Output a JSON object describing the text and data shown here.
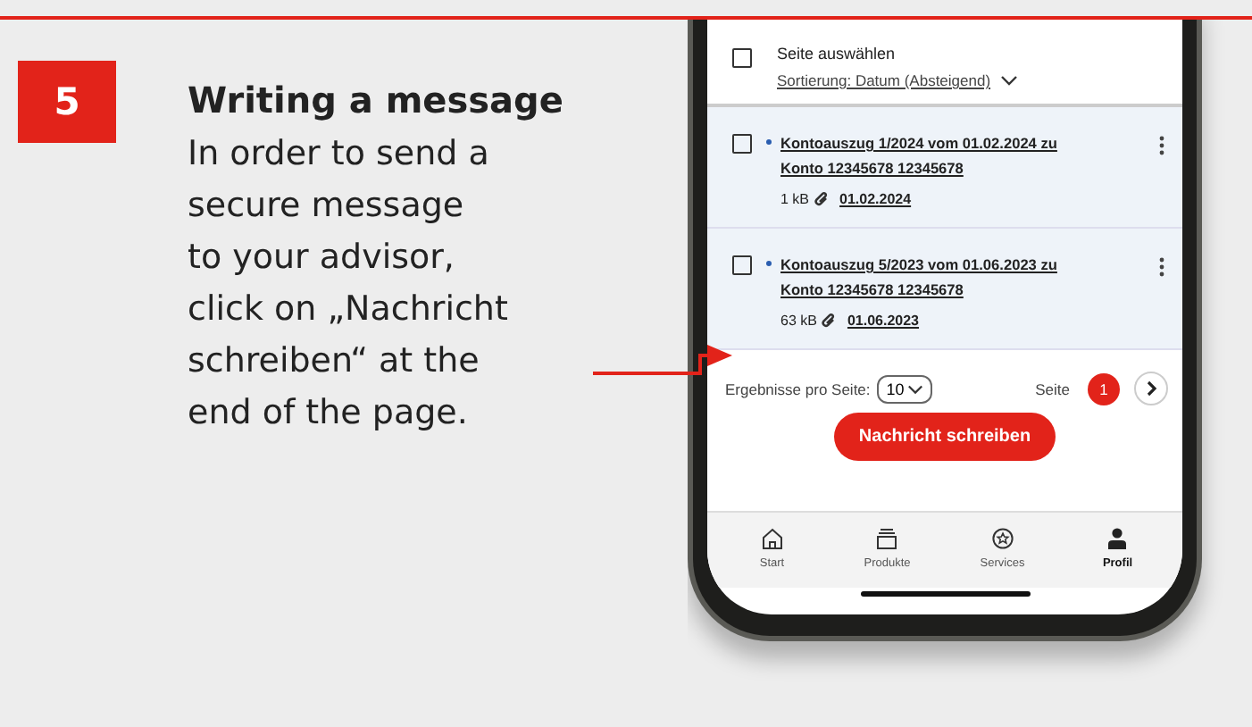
{
  "step": {
    "number": "5",
    "title": "Writing a message",
    "body": "In order to send a\nsecure message\nto your advisor,\nclick on „Nachricht\nschreiben“ at the\nend of the page."
  },
  "phone": {
    "select_all": {
      "label": "Seite auswählen",
      "checked": false
    },
    "sort": {
      "label": "Sortierung: Datum (Absteigend)"
    },
    "documents": [
      {
        "title": "Kontoauszug 1/2024 vom 01.02.2024 zu Konto 12345678  12345678",
        "unread": true,
        "checked": false,
        "size": "1 kB",
        "date": "01.02.2024"
      },
      {
        "title": "Kontoauszug 5/2023 vom 01.06.2023 zu Konto 12345678  12345678",
        "unread": true,
        "checked": false,
        "size": "63 kB",
        "date": "01.06.2023"
      }
    ],
    "pagination": {
      "label": "Ergebnisse pro Seite:",
      "page_size": "10",
      "page_label": "Seite",
      "pages": [
        {
          "label": "1",
          "selected": true
        }
      ]
    },
    "primary_button": "Nachricht schreiben",
    "nav": [
      {
        "kind": "home",
        "label": "Start",
        "selected": false
      },
      {
        "kind": "products",
        "label": "Produkte",
        "selected": false
      },
      {
        "kind": "services",
        "label": "Services",
        "selected": false
      },
      {
        "kind": "profile",
        "label": "Profil",
        "selected": true
      }
    ]
  }
}
